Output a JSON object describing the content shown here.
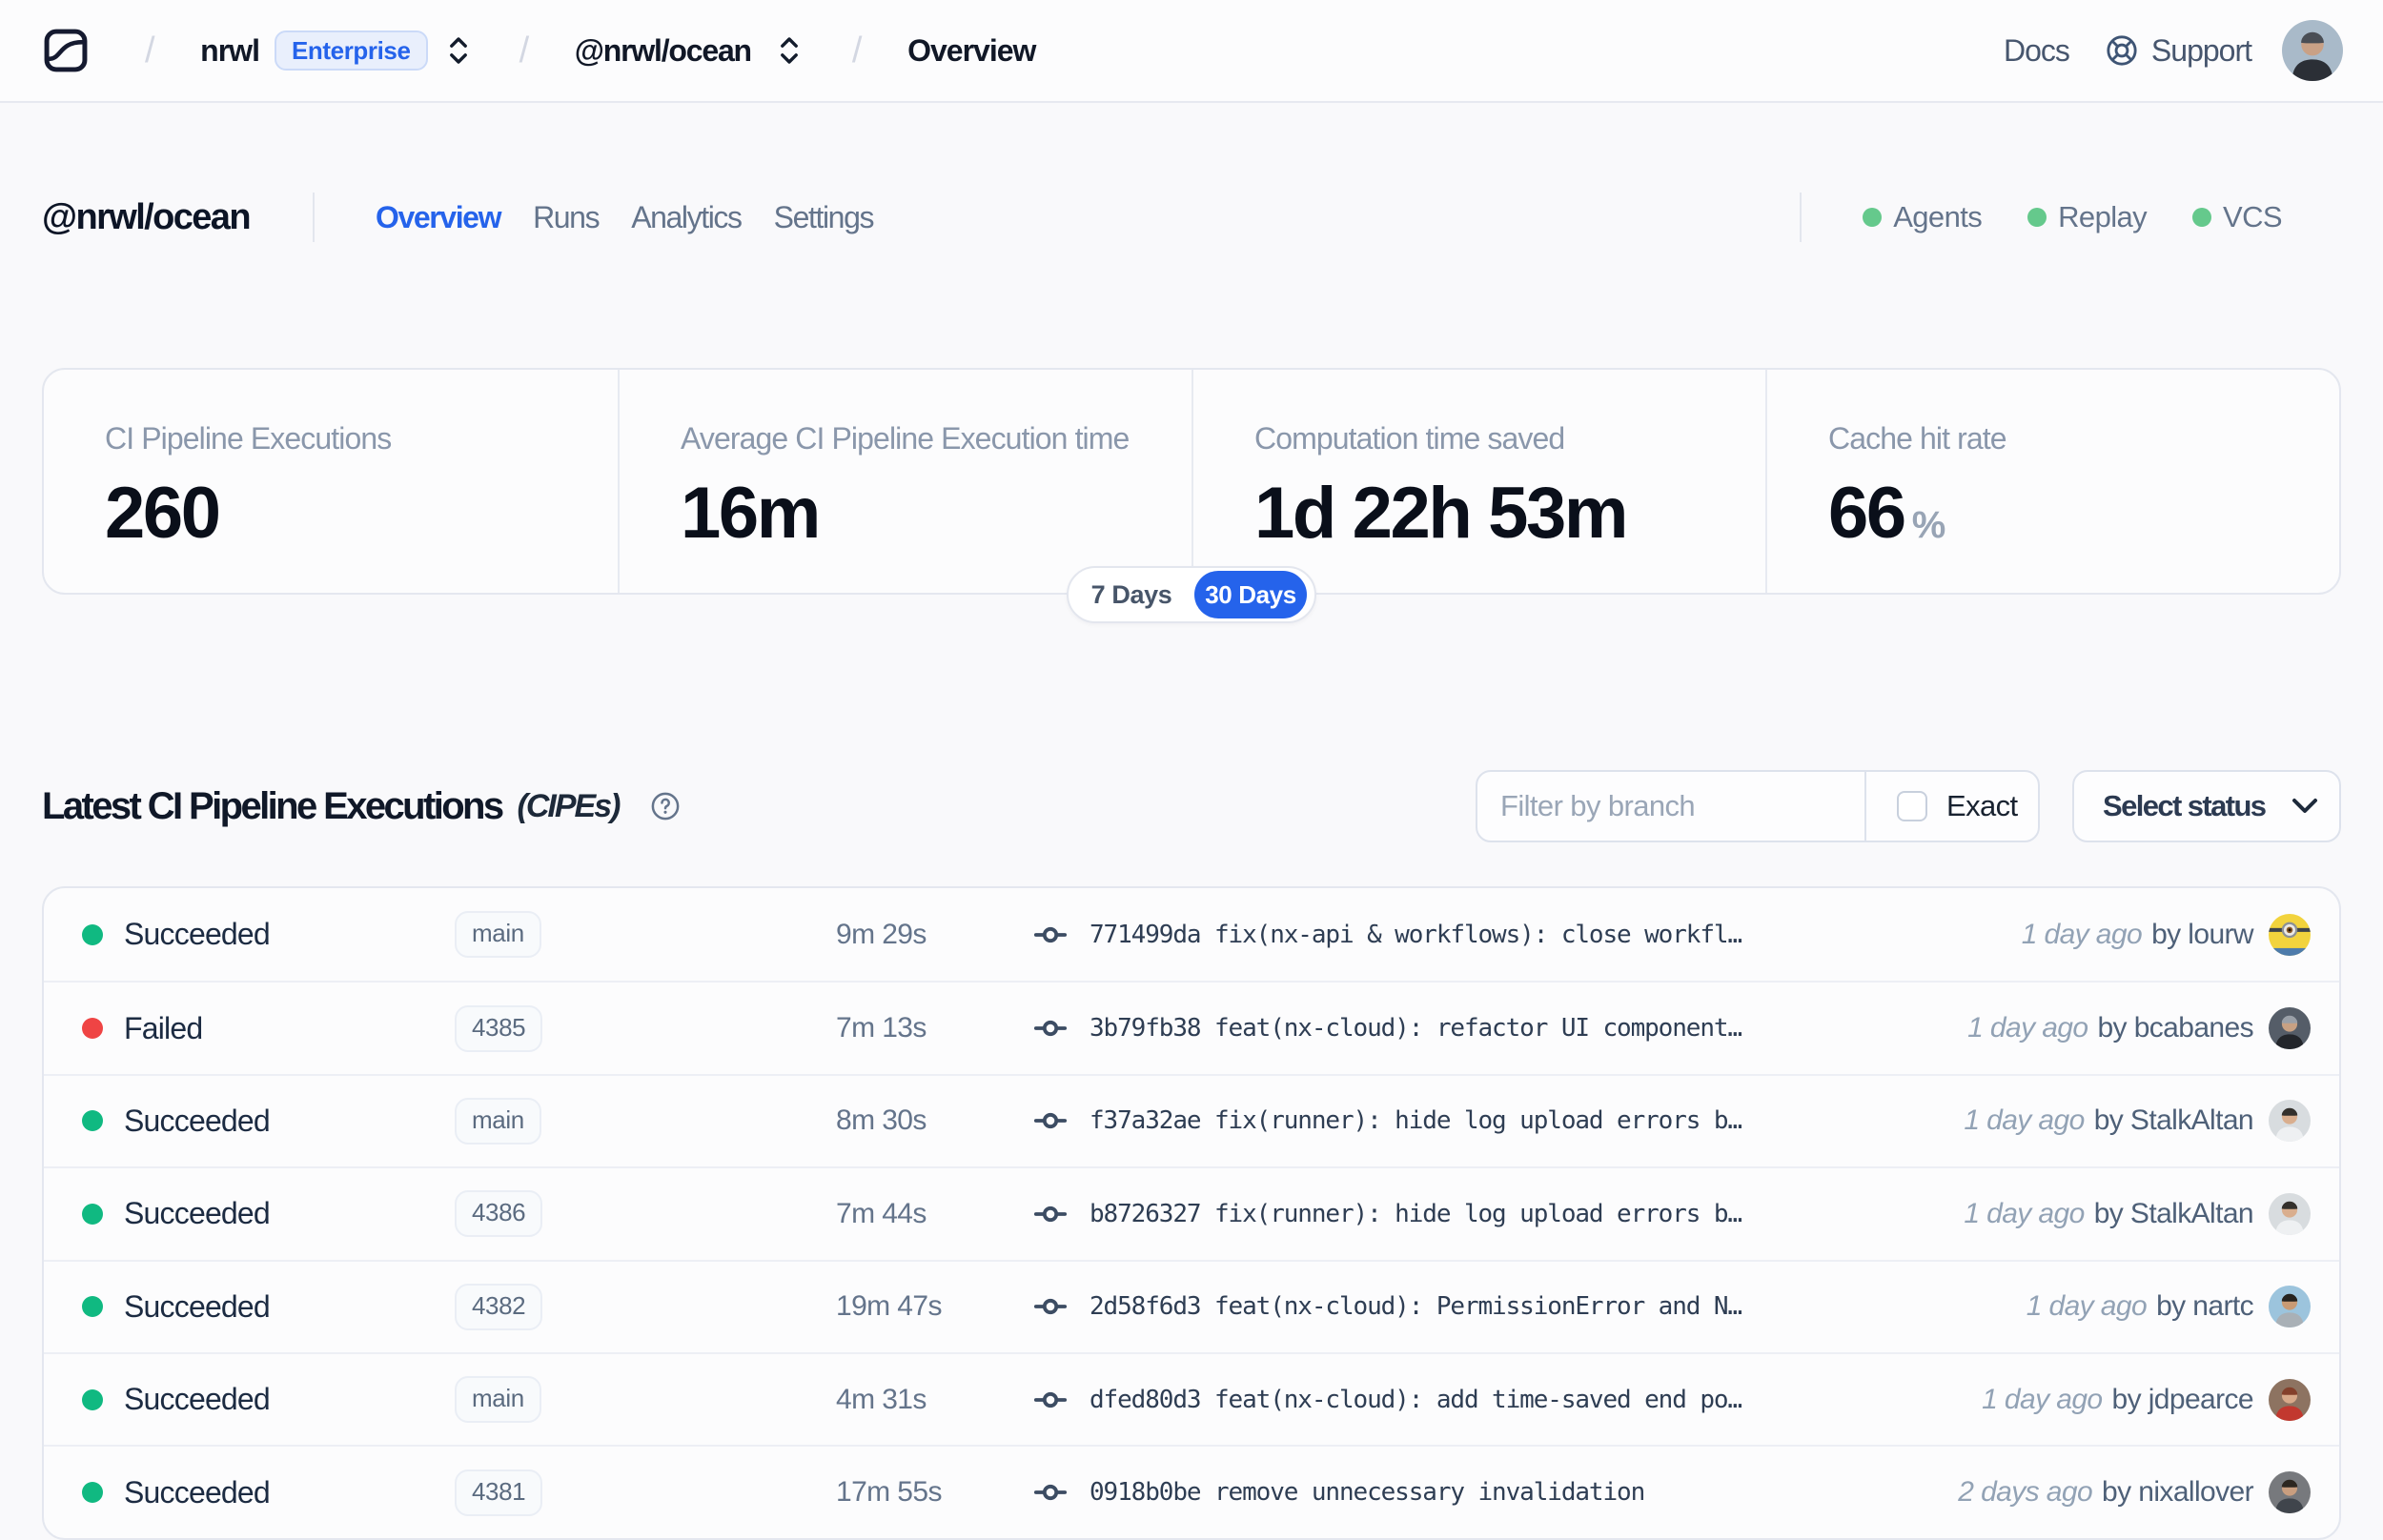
{
  "header": {
    "brand": "Nx Cloud",
    "breadcrumb": {
      "org": "nrwl",
      "plan_badge": "Enterprise",
      "workspace": "@nrwl/ocean",
      "page": "Overview"
    },
    "docs_label": "Docs",
    "support_label": "Support"
  },
  "workspace": {
    "title": "@nrwl/ocean",
    "tabs": [
      {
        "label": "Overview",
        "active": true
      },
      {
        "label": "Runs",
        "active": false
      },
      {
        "label": "Analytics",
        "active": false
      },
      {
        "label": "Settings",
        "active": false
      }
    ],
    "features": [
      {
        "label": "Agents",
        "status_color": "#65c98c"
      },
      {
        "label": "Replay",
        "status_color": "#65c98c"
      },
      {
        "label": "VCS",
        "status_color": "#65c98c"
      }
    ]
  },
  "stats": {
    "cards": [
      {
        "label": "CI Pipeline Executions",
        "value": "260",
        "suffix": ""
      },
      {
        "label": "Average CI Pipeline Execution time",
        "value": "16m",
        "suffix": ""
      },
      {
        "label": "Computation time saved",
        "value": "1d 22h 53m",
        "suffix": ""
      },
      {
        "label": "Cache hit rate",
        "value": "66",
        "suffix": "%"
      }
    ],
    "range_toggle": {
      "inactive": "7 Days",
      "active": "30 Days"
    }
  },
  "cipe": {
    "title": "Latest CI Pipeline Executions",
    "title_suffix": "(CIPEs)",
    "filter_placeholder": "Filter by branch",
    "exact_label": "Exact",
    "status_select_label": "Select status",
    "rows": [
      {
        "status": "Succeeded",
        "status_color": "#10b981",
        "branch": "main",
        "duration": "9m 29s",
        "commit": "771499da fix(nx-api & workflows): close workfl…",
        "time_ago": "1 day ago",
        "author": "by lourw",
        "avatar": {
          "kind": "minion",
          "bg": "#f2d33d",
          "hair": "#3d434c",
          "skin": "#e7e4de",
          "shirt": "#4d7bab"
        }
      },
      {
        "status": "Failed",
        "status_color": "#ef4444",
        "branch": "4385",
        "duration": "7m 13s",
        "commit": "3b79fb38 feat(nx-cloud): refactor UI component…",
        "time_ago": "1 day ago",
        "author": "by bcabanes",
        "avatar": {
          "kind": "person",
          "bg": "#555d68",
          "hair": "#9aa0a8",
          "skin": "#c8a183",
          "shirt": "#23262b"
        }
      },
      {
        "status": "Succeeded",
        "status_color": "#10b981",
        "branch": "main",
        "duration": "8m 30s",
        "commit": "f37a32ae fix(runner): hide log upload errors b…",
        "time_ago": "1 day ago",
        "author": "by StalkAltan",
        "avatar": {
          "kind": "person",
          "bg": "#d8dcdf",
          "hair": "#33302c",
          "skin": "#d9ae8e",
          "shirt": "#eef0f2"
        }
      },
      {
        "status": "Succeeded",
        "status_color": "#10b981",
        "branch": "4386",
        "duration": "7m 44s",
        "commit": "b8726327 fix(runner): hide log upload errors b…",
        "time_ago": "1 day ago",
        "author": "by StalkAltan",
        "avatar": {
          "kind": "person",
          "bg": "#d8dcdf",
          "hair": "#33302c",
          "skin": "#d9ae8e",
          "shirt": "#eef0f2"
        }
      },
      {
        "status": "Succeeded",
        "status_color": "#10b981",
        "branch": "4382",
        "duration": "19m 47s",
        "commit": "2d58f6d3 feat(nx-cloud): PermissionError and N…",
        "time_ago": "1 day ago",
        "author": "by nartc",
        "avatar": {
          "kind": "person",
          "bg": "#9cc4dd",
          "hair": "#26231f",
          "skin": "#c89a74",
          "shirt": "#a9b0b6"
        }
      },
      {
        "status": "Succeeded",
        "status_color": "#10b981",
        "branch": "main",
        "duration": "4m 31s",
        "commit": "dfed80d3 feat(nx-cloud): add time-saved end po…",
        "time_ago": "1 day ago",
        "author": "by jdpearce",
        "avatar": {
          "kind": "person",
          "bg": "#8d7361",
          "hair": "#84402b",
          "skin": "#d8a98a",
          "shirt": "#c2382f"
        }
      },
      {
        "status": "Succeeded",
        "status_color": "#10b981",
        "branch": "4381",
        "duration": "17m 55s",
        "commit": "0918b0be remove unnecessary invalidation",
        "time_ago": "2 days ago",
        "author": "by nixallover",
        "avatar": {
          "kind": "person",
          "bg": "#77797d",
          "hair": "#2c2620",
          "skin": "#c99e7f",
          "shirt": "#40454c"
        }
      }
    ]
  },
  "user_avatar": {
    "kind": "person",
    "bg": "#a9bac9",
    "hair": "#4a4e55",
    "skin": "#c9a186",
    "shirt": "#2b2f36"
  }
}
